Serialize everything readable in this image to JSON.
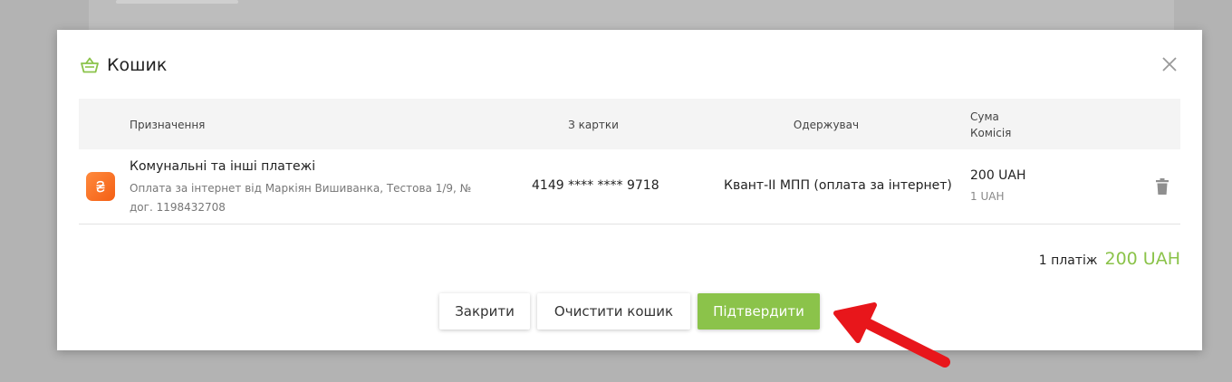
{
  "modal": {
    "title": "Кошик",
    "table": {
      "headers": {
        "purpose": "Призначення",
        "card": "З картки",
        "recipient": "Одержувач",
        "amount": "Сума",
        "fee": "Комісія"
      },
      "rows": [
        {
          "icon": "hryvnia-icon",
          "title": "Комунальні та інші платежі",
          "description": "Оплата за інтернет від Маркіян Вишиванка, Тестова 1/9, № дог. 1198432708",
          "card": "4149 **** **** 9718",
          "recipient": "Квант-ІІ МПП (оплата за інтернет)",
          "amount": "200 UAH",
          "fee": "1 UAH"
        }
      ]
    },
    "summary": {
      "count": "1 платіж",
      "total": "200 UAH"
    },
    "buttons": {
      "close": "Закрити",
      "clear": "Очистити кошик",
      "confirm": "Підтвердити"
    }
  },
  "colors": {
    "accent": "#8bc34a",
    "overlay": "#b3b3b3",
    "icon_orange": "#f46a1f",
    "annotation_arrow": "#e8161b"
  }
}
